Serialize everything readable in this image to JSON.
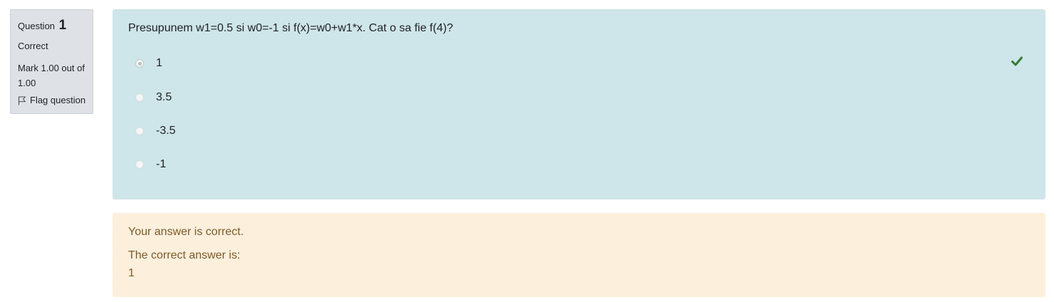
{
  "info": {
    "question_label": "Question",
    "question_number": "1",
    "state": "Correct",
    "grade": "Mark 1.00 out of 1.00",
    "flag_label": "Flag question",
    "flag_icon": "flag-outline-icon"
  },
  "question": {
    "text": "Presupunem w1=0.5 si w0=-1 si f(x)=w0+w1*x. Cat o sa fie f(4)?",
    "options": [
      {
        "label": "1",
        "selected": true
      },
      {
        "label": "3.5",
        "selected": false
      },
      {
        "label": "-3.5",
        "selected": false
      },
      {
        "label": "-1",
        "selected": false
      }
    ],
    "correct_icon": "check-icon"
  },
  "outcome": {
    "feedback": "Your answer is correct.",
    "right_answer_label": "The correct answer is:",
    "right_answer_value": "1"
  },
  "colors": {
    "info_bg": "#dee2e6",
    "formulation_bg": "#cee5e9",
    "outcome_bg": "#fcefdc",
    "outcome_text": "#7d5a29",
    "check_green": "#357a32"
  }
}
